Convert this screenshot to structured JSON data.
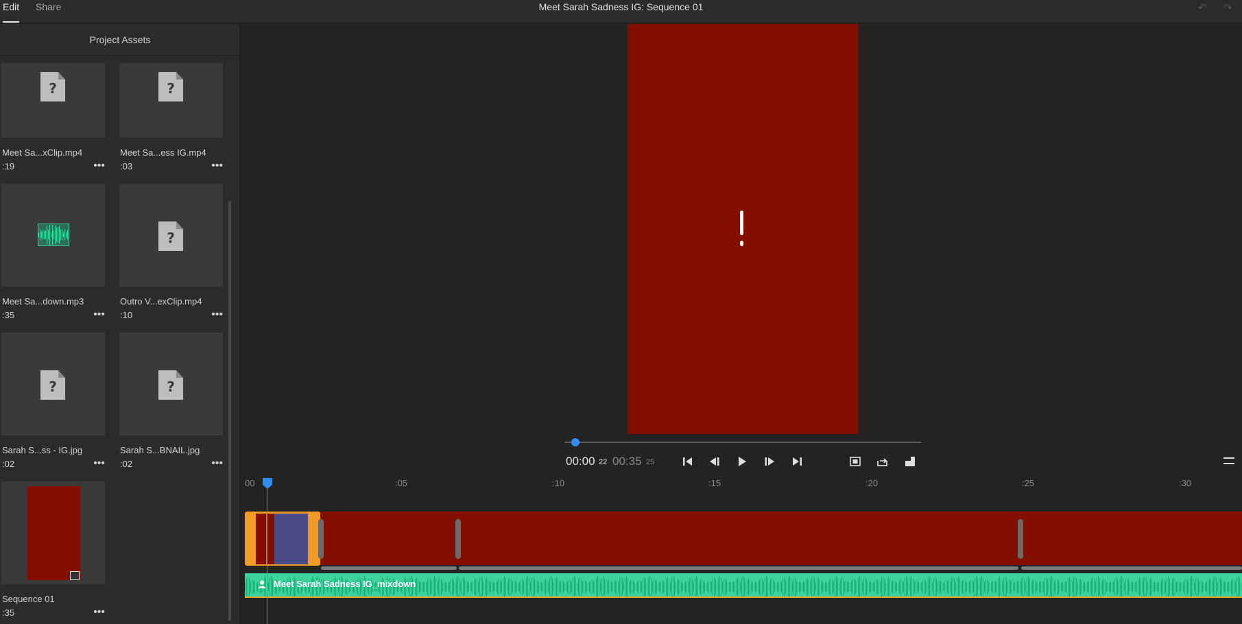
{
  "topbar": {
    "tabs": [
      {
        "label": "Edit",
        "active": true
      },
      {
        "label": "Share",
        "active": false
      }
    ],
    "title": "Meet Sarah Sadness IG: Sequence 01",
    "undo_icon": "undo-icon",
    "redo_icon": "redo-icon"
  },
  "project_panel": {
    "header": "Project Assets",
    "assets": [
      {
        "name": "Meet Sa...xClip.mp4",
        "duration": ":19",
        "kind": "missing-video"
      },
      {
        "name": "Meet Sa...ess IG.mp4",
        "duration": ":03",
        "kind": "missing-video"
      },
      {
        "name": "Meet Sa...down.mp3",
        "duration": ":35",
        "kind": "audio"
      },
      {
        "name": "Outro V...exClip.mp4",
        "duration": ":10",
        "kind": "missing-video"
      },
      {
        "name": "Sarah S...ss - IG.jpg",
        "duration": ":02",
        "kind": "missing-image"
      },
      {
        "name": "Sarah S...BNAIL.jpg",
        "duration": ":02",
        "kind": "missing-image"
      },
      {
        "name": "Sequence 01",
        "duration": ":35",
        "kind": "sequence"
      }
    ],
    "more_label": "•••",
    "missing_glyph": "?"
  },
  "viewer": {
    "current_time": "00:00",
    "current_frames": "22",
    "total_time": "00:35",
    "total_frames": "25",
    "playback_progress": 0.02,
    "controls": [
      "go-to-start-icon",
      "step-back-icon",
      "play-icon",
      "step-forward-icon",
      "go-to-end-icon",
      "fit-frame-icon",
      "export-frame-icon",
      "aspect-ratio-icon"
    ],
    "frame_color": "#820f00",
    "warning_glyph": "!"
  },
  "timeline": {
    "ruler_ticks": [
      "00",
      ":05",
      ":10",
      ":15",
      ":20",
      ":25",
      ":30"
    ],
    "audio_clip_name": "Meet Sarah Sadness IG_mixdown",
    "colors": {
      "playhead": "#2f8df0",
      "video_clip": "#820f00",
      "selected_clip": "#f29b26",
      "audio_clip": "#3dd39d"
    }
  }
}
